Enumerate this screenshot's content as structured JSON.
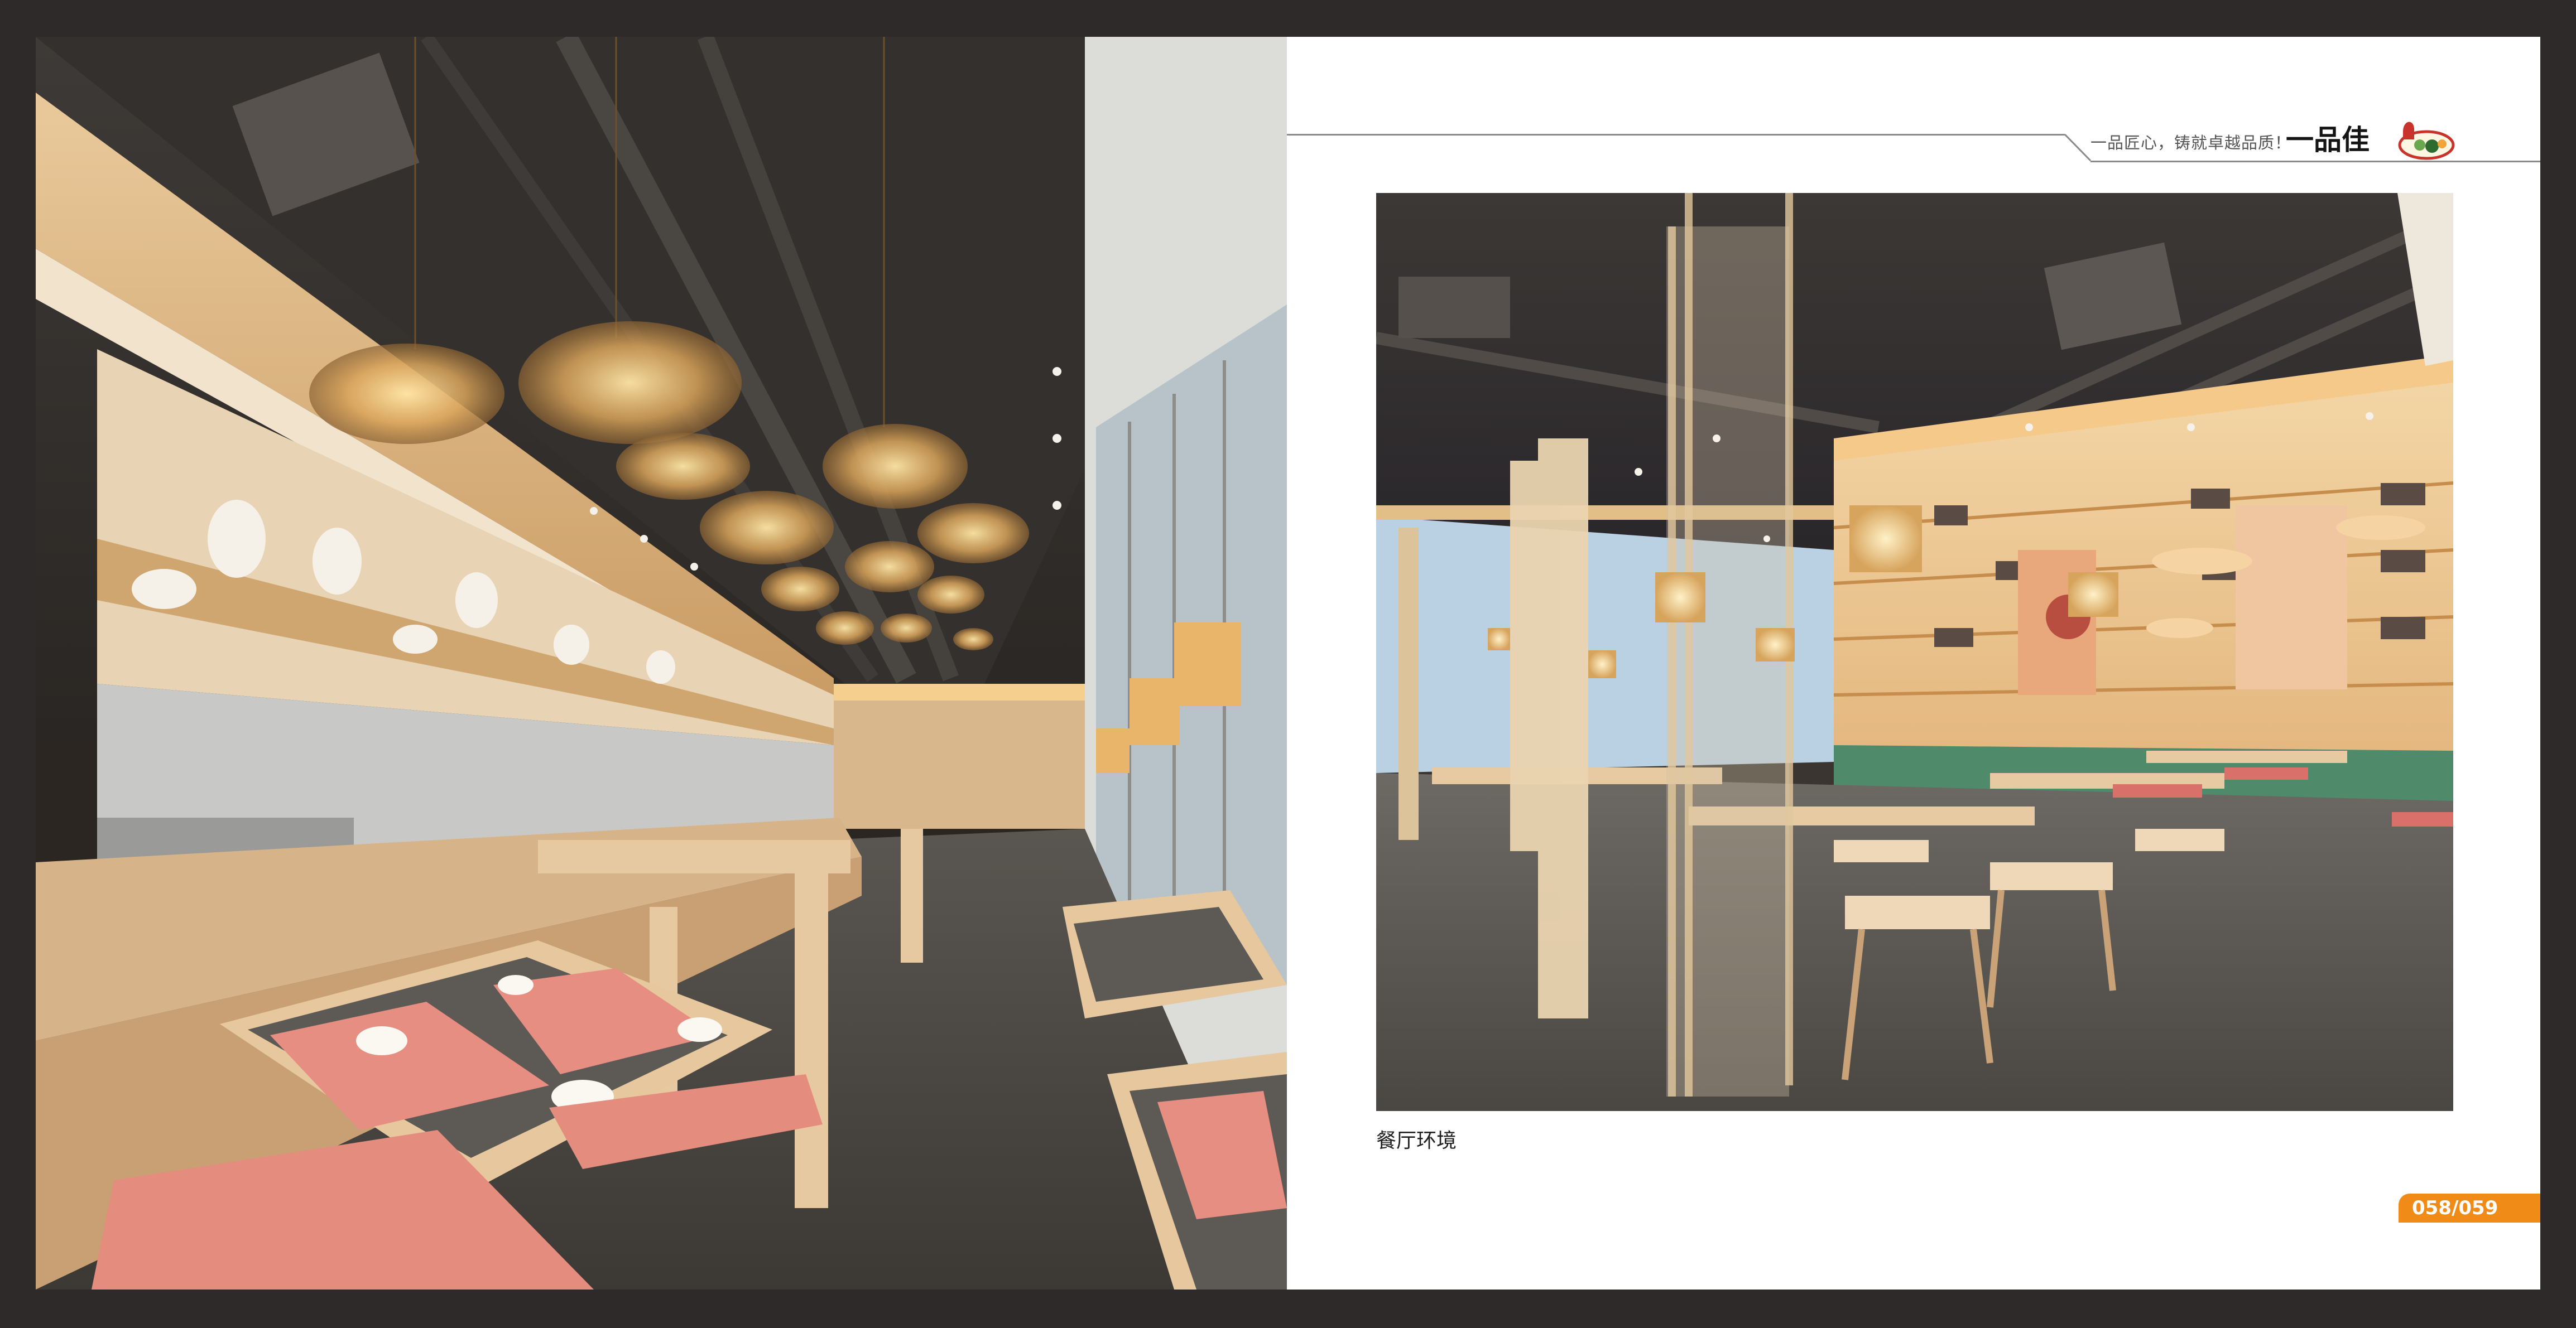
{
  "header": {
    "tagline": "一品匠心，铸就卓越品质！",
    "brand_name": "一品佳"
  },
  "photos": {
    "left": {
      "subject": "restaurant-interior-booths-rattan-pendants"
    },
    "right": {
      "subject": "restaurant-dining-hall-bookshelf-wall"
    }
  },
  "caption": "餐厅环境",
  "page_number": "058/059",
  "colors": {
    "background": "#2e2a2a",
    "page": "#ffffff",
    "accent": "#f08b18",
    "wood": "#d9b487",
    "lamp": "#f7c46a",
    "seat": "#d9706a"
  }
}
